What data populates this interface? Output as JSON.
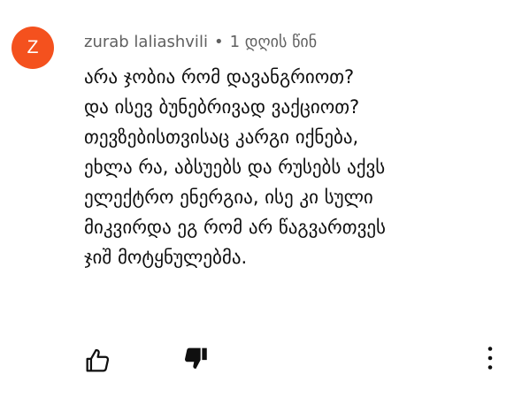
{
  "comment": {
    "avatar_letter": "Z",
    "avatar_color": "#f4511e",
    "author": "zurab laliashvili",
    "separator": "•",
    "timestamp": "1 დღის წინ",
    "lines": [
      "არა ჯობია რომ დავანგრიოთ?",
      "და ისევ ბუნებრივად ვაქციოთ?",
      "თევზებისთვისაც კარგი იქნება,",
      "ეხლა რა, აბსუებს და რუსებს აქვს",
      "ელექტრო ენერგია, ისე კი სული",
      "მიკვირდა ეგ რომ არ წაგვართვეს",
      "ჯიშ მოტყნულებმა."
    ]
  },
  "actions": {
    "like_icon": "thumbs-up-outline-icon",
    "dislike_icon": "thumbs-down-filled-icon",
    "more_icon": "more-vertical-icon"
  }
}
